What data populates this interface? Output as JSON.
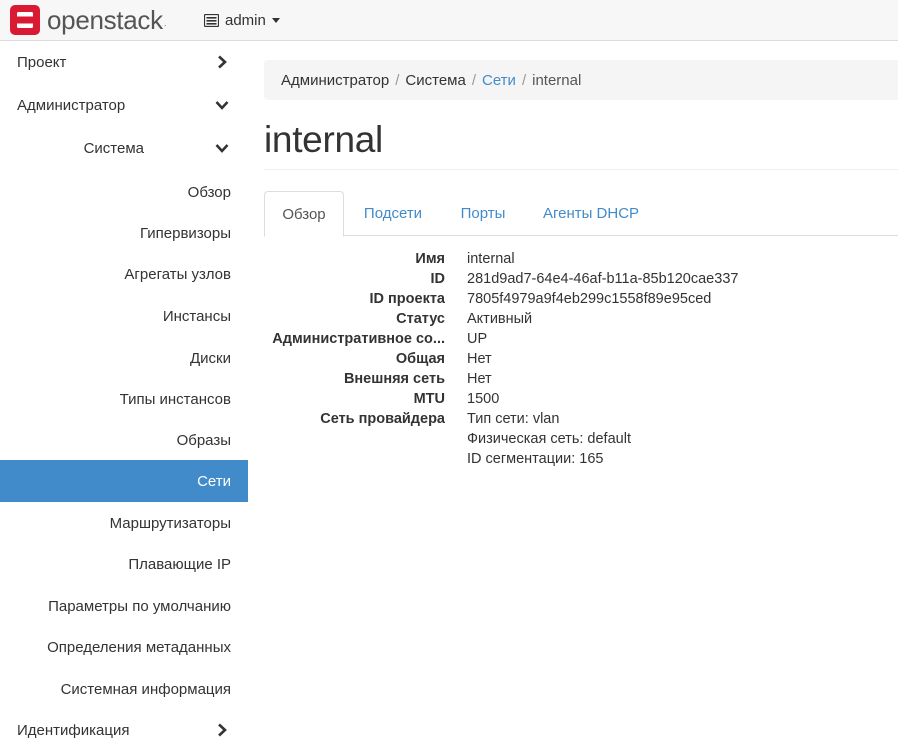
{
  "header": {
    "brand": "openstack",
    "brand_tm": ".",
    "project": "admin"
  },
  "colors": {
    "accent": "#428bca",
    "brand_red": "#da1a32"
  },
  "sidebar": {
    "items": [
      {
        "label": "Проект",
        "level": 1,
        "icon": "chevron-right-icon"
      },
      {
        "label": "Администратор",
        "level": 1,
        "icon": "chevron-down-icon"
      },
      {
        "label": "Система",
        "level": 2,
        "icon": "chevron-down-icon"
      },
      {
        "label": "Обзор",
        "level": 3
      },
      {
        "label": "Гипервизоры",
        "level": 3
      },
      {
        "label": "Агрегаты узлов",
        "level": 3
      },
      {
        "label": "Инстансы",
        "level": 3
      },
      {
        "label": "Диски",
        "level": 3
      },
      {
        "label": "Типы инстансов",
        "level": 3
      },
      {
        "label": "Образы",
        "level": 3
      },
      {
        "label": "Сети",
        "level": 3,
        "active": true
      },
      {
        "label": "Маршрутизаторы",
        "level": 3
      },
      {
        "label": "Плавающие IP",
        "level": 3
      },
      {
        "label": "Параметры по умолчанию",
        "level": 3
      },
      {
        "label": "Определения метаданных",
        "level": 3
      },
      {
        "label": "Системная информация",
        "level": 3
      },
      {
        "label": "Идентификация",
        "level": 1,
        "icon": "chevron-right-icon"
      }
    ]
  },
  "breadcrumb": {
    "items": [
      "Администратор",
      "Система",
      "Сети",
      "internal"
    ],
    "separator": "/"
  },
  "page": {
    "title": "internal"
  },
  "tabs": [
    "Обзор",
    "Подсети",
    "Порты",
    "Агенты DHCP"
  ],
  "details": {
    "rows": [
      {
        "label": "Имя",
        "value": "internal"
      },
      {
        "label": "ID",
        "value": "281d9ad7-64e4-46af-b11a-85b120cae337"
      },
      {
        "label": "ID проекта",
        "value": "7805f4979a9f4eb299c1558f89e95ced"
      },
      {
        "label": "Статус",
        "value": "Активный"
      },
      {
        "label": "Административное со...",
        "value": "UP"
      },
      {
        "label": "Общая",
        "value": "Нет"
      },
      {
        "label": "Внешняя сеть",
        "value": "Нет"
      },
      {
        "label": "MTU",
        "value": "1500"
      },
      {
        "label": "Сеть провайдера",
        "value": "Тип сети: vlan"
      },
      {
        "label": "",
        "value": "Физическая сеть: default"
      },
      {
        "label": "",
        "value": "ID сегментации: 165"
      }
    ]
  }
}
